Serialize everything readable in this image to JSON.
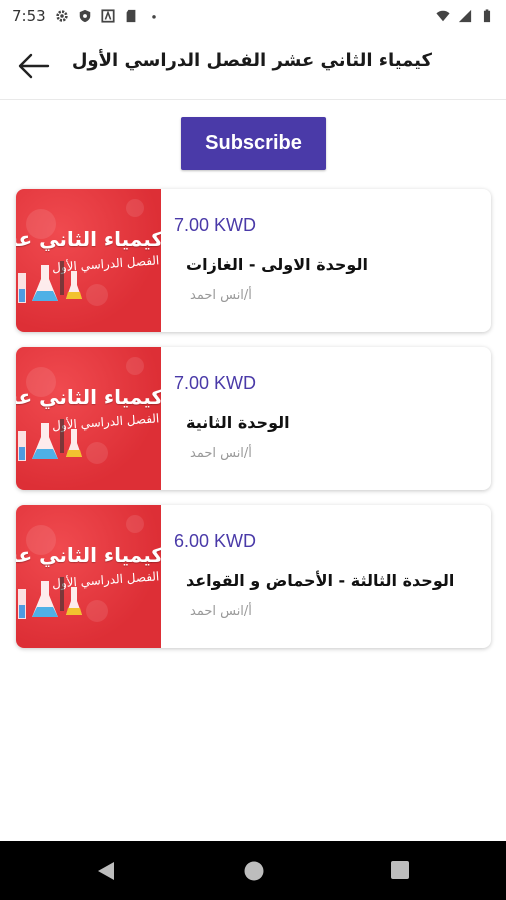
{
  "status_bar": {
    "time": "7:53",
    "left_icons": [
      "settings-icon",
      "shield-icon",
      "font-icon",
      "sd-card-icon",
      "dot-icon"
    ],
    "right_icons": [
      "wifi-icon",
      "signal-icon",
      "battery-icon"
    ]
  },
  "app_bar": {
    "title": "كيمياء الثاني عشر الفصل الدراسي الأول",
    "back_icon": "arrow-left-icon"
  },
  "subscribe": {
    "label": "Subscribe",
    "color": "#4a3aa8"
  },
  "courses": [
    {
      "price": "7.00 KWD",
      "title": "الوحدة الاولى - الغازات",
      "teacher": "أ/انس احمد",
      "thumb_title": "كيمياء الثاني عشر",
      "thumb_sub": "الفصل الدراسي الأول"
    },
    {
      "price": "7.00 KWD",
      "title": "الوحدة الثانية",
      "teacher": "أ/انس احمد",
      "thumb_title": "كيمياء الثاني عشر",
      "thumb_sub": "الفصل الدراسي الأول"
    },
    {
      "price": "6.00 KWD",
      "title": "الوحدة الثالثة - الأحماض و القواعد",
      "teacher": "أ/انس احمد",
      "thumb_title": "كيمياء الثاني عشر",
      "thumb_sub": "الفصل الدراسي الأول"
    }
  ],
  "nav_bar": {
    "buttons": [
      "back-triangle-icon",
      "home-circle-icon",
      "recents-square-icon"
    ]
  },
  "colors": {
    "accent": "#4a3aa8",
    "thumb_red": "#e0333a"
  }
}
